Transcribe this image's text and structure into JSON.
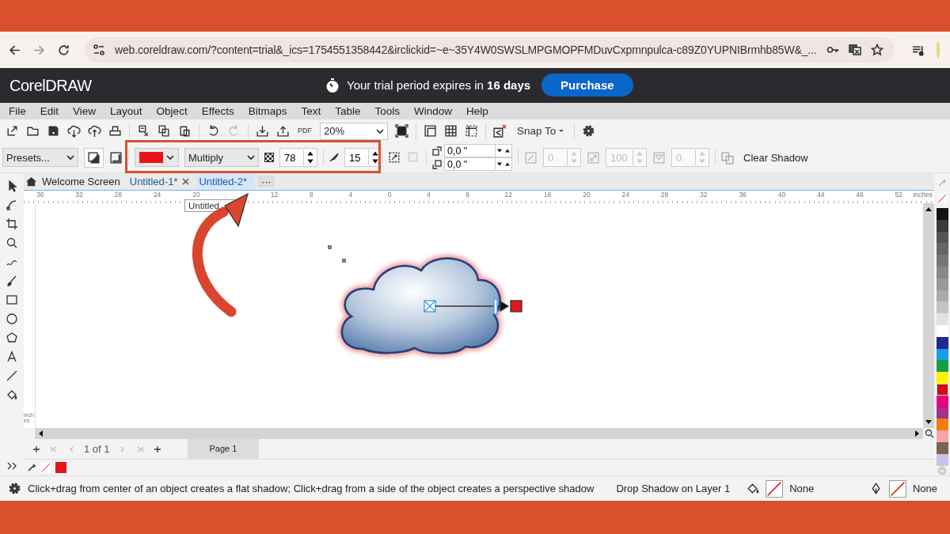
{
  "browser": {
    "url": "web.coreldraw.com/?content=trial&_ics=1754551358442&irclickid=~e~35Y4W0SWSLMPGMOPFMDuvCxpmnpulca-c89Z0YUPNIBrmhb85W&_..."
  },
  "header": {
    "logo": "CorelDRAW",
    "trial_message": "Your trial period expires in **16 days**",
    "purchase_button": "Purchase"
  },
  "menu": [
    "File",
    "Edit",
    "View",
    "Layout",
    "Object",
    "Effects",
    "Bitmaps",
    "Text",
    "Table",
    "Tools",
    "Window",
    "Help"
  ],
  "toolbar": {
    "pdf_label": "PDF",
    "zoom": "20%",
    "snap_to": "Snap To"
  },
  "property_bar": {
    "presets": "Presets...",
    "shadow_swatch": {
      "color": "#e8141c"
    },
    "blend_mode": "Multiply",
    "opacity": "78",
    "feather": "15",
    "offset_x": "0,0 \"",
    "offset_y": "0,0 \"",
    "fade": "0",
    "stretch": "100",
    "angle": "0",
    "clear_shadow": "Clear Shadow"
  },
  "tabs": [
    {
      "label": "Welcome Screen",
      "kind": "home",
      "selected": false,
      "closable": false
    },
    {
      "label": "Untitled-1*",
      "kind": "document",
      "selected": false,
      "closable": true
    },
    {
      "label": "Untitled-2*",
      "kind": "document",
      "selected": true,
      "closable": false
    }
  ],
  "tab_overflow": "···",
  "tooltip": "Untitled",
  "ruler": {
    "left_labels": [
      "36",
      "32",
      "28",
      "24",
      "20"
    ],
    "right_labels": [
      "12",
      "8",
      "4",
      "0",
      "4",
      "8",
      "12",
      "16",
      "20",
      "24",
      "28",
      "32",
      "36",
      "40",
      "44",
      "48",
      "52"
    ],
    "unit": "inches"
  },
  "vertical_ruler": {
    "unit": "inches"
  },
  "page_nav": {
    "page_count": "1 of 1",
    "page_tab": "Page 1"
  },
  "document_colors": [
    {
      "color": "#e8141c"
    }
  ],
  "palette": [
    {
      "color": "#111111",
      "selected": false
    },
    {
      "color": "#3a3a3a",
      "selected": false
    },
    {
      "color": "#545454",
      "selected": false
    },
    {
      "color": "#666666",
      "selected": false
    },
    {
      "color": "#777777",
      "selected": false
    },
    {
      "color": "#888888",
      "selected": false
    },
    {
      "color": "#999999",
      "selected": false
    },
    {
      "color": "#aaaaaa",
      "selected": false
    },
    {
      "color": "#c4c4c4",
      "selected": false
    },
    {
      "color": "#e2e2e2",
      "selected": false
    },
    {
      "color": "#ffffff",
      "selected": false
    },
    {
      "color": "#1e2a8c",
      "selected": false
    },
    {
      "color": "#14a0e0",
      "selected": false
    },
    {
      "color": "#12a04a",
      "selected": false
    },
    {
      "color": "#fff200",
      "selected": false
    },
    {
      "color": "#e30613",
      "selected": true
    },
    {
      "color": "#e6007e",
      "selected": false
    },
    {
      "color": "#a3308c",
      "selected": false
    },
    {
      "color": "#f07d0a",
      "selected": false
    },
    {
      "color": "#f4a6a6",
      "selected": false
    },
    {
      "color": "#7a6458",
      "selected": false
    },
    {
      "color": "#c8c4e6",
      "selected": false
    }
  ],
  "status_bar": {
    "hint": "Click+drag from center of an object creates a flat shadow; Click+drag from a side of the object creates a perspective shadow",
    "layer": "Drop Shadow on Layer 1",
    "fill": "None",
    "outline": "None"
  }
}
